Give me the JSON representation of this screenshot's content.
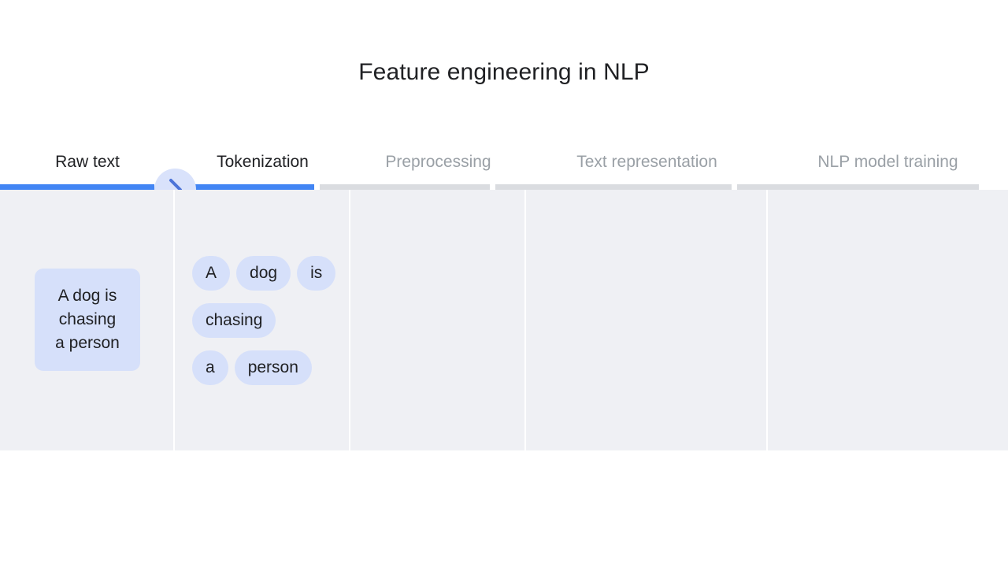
{
  "page": {
    "title": "Feature engineering in NLP",
    "accent_color": "#4285f4",
    "chip_color": "#d6e0fa",
    "panel_color": "#eff0f4",
    "inactive_color": "#dadce0",
    "active_text_color": "#202124",
    "inactive_text_color": "#9aa0a6"
  },
  "stepper": {
    "steps": [
      {
        "label": "Raw text",
        "state": "done"
      },
      {
        "label": "Tokenization",
        "state": "current"
      },
      {
        "label": "Preprocessing",
        "state": "upcoming"
      },
      {
        "label": "Text representation",
        "state": "upcoming"
      },
      {
        "label": "NLP model training",
        "state": "upcoming"
      }
    ],
    "chevron_icon": "chevron-right-icon"
  },
  "columns": {
    "raw_text": {
      "card_lines": [
        "A dog is",
        "chasing",
        "a person"
      ],
      "card_text": "A dog is chasing a person"
    },
    "tokenization": {
      "rows": [
        [
          "A",
          "dog",
          "is"
        ],
        [
          "chasing"
        ],
        [
          "a",
          "person"
        ]
      ],
      "tokens": [
        "A",
        "dog",
        "is",
        "chasing",
        "a",
        "person"
      ]
    },
    "preprocessing": {
      "content": ""
    },
    "text_representation": {
      "content": ""
    },
    "nlp_model_training": {
      "content": ""
    }
  }
}
